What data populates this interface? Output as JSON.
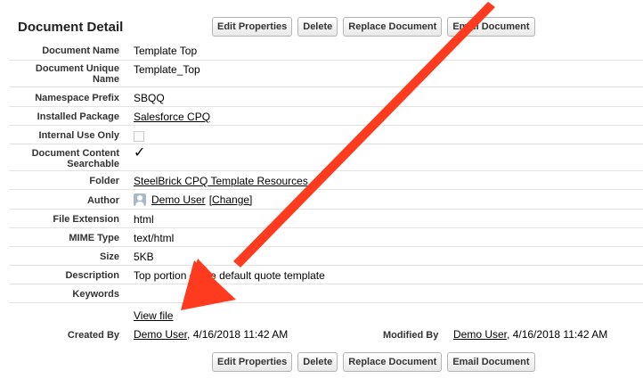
{
  "section_title": "Document Detail",
  "buttons": {
    "edit": "Edit Properties",
    "delete": "Delete",
    "replace": "Replace Document",
    "email": "Email Document"
  },
  "fields": {
    "document_name": {
      "label": "Document Name",
      "value": "Template Top"
    },
    "document_unique_name": {
      "label": "Document Unique Name",
      "value": "Template_Top"
    },
    "namespace_prefix": {
      "label": "Namespace Prefix",
      "value": "SBQQ"
    },
    "installed_package": {
      "label": "Installed Package",
      "value": "Salesforce CPQ"
    },
    "internal_use_only": {
      "label": "Internal Use Only",
      "checked": false
    },
    "content_searchable": {
      "label": "Document Content Searchable",
      "value": "✓"
    },
    "folder": {
      "label": "Folder",
      "value": "SteelBrick CPQ Template Resources"
    },
    "author": {
      "label": "Author",
      "user": "Demo User",
      "change": "[Change]"
    },
    "file_extension": {
      "label": "File Extension",
      "value": "html"
    },
    "mime_type": {
      "label": "MIME Type",
      "value": "text/html"
    },
    "size": {
      "label": "Size",
      "value": "5KB"
    },
    "description": {
      "label": "Description",
      "value": "Top portion of the default quote template"
    },
    "keywords": {
      "label": "Keywords",
      "value": ""
    }
  },
  "view_file": "View file",
  "created_by": {
    "label": "Created By",
    "user": "Demo User",
    "date": ", 4/16/2018 11:42 AM"
  },
  "modified_by": {
    "label": "Modified By",
    "user": "Demo User",
    "date": ", 4/16/2018 11:42 AM"
  },
  "colors": {
    "arrow": "#ff3b1f"
  }
}
